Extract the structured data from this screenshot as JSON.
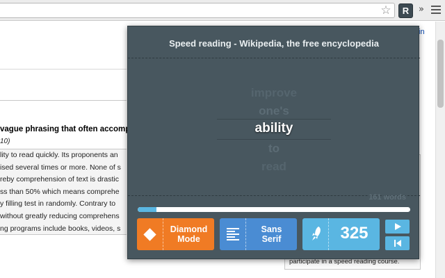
{
  "browser": {
    "extension_button_label": "R",
    "more_label": "»"
  },
  "page": {
    "login_fragment": "in",
    "heading": "vague phrasing that often accompa",
    "date_fragment": "10)",
    "article_lines": [
      "lity to read quickly. Its proponents an",
      "ised several times or more. None of s",
      "reby comprehension of text is drastic",
      "ss than 50% which means comprehe",
      "y filling test in randomly. Contrary to",
      "without greatly reducing comprehens",
      "ng programs include books, videos, s"
    ],
    "sidebar_text": "participate in a speed reading course."
  },
  "popup": {
    "title": "Speed reading - Wikipedia, the free encyclopedia",
    "words_before": [
      "improve",
      "one's"
    ],
    "focus_word": "ability",
    "words_after": [
      "to",
      "read"
    ],
    "word_count": "161 words",
    "progress_fraction": 0.07,
    "diamond_button": {
      "line1": "Diamond",
      "line2": "Mode"
    },
    "font_button": {
      "line1": "Sans",
      "line2": "Serif"
    },
    "speed_value": "325",
    "colors": {
      "background": "#48575f",
      "accent_orange": "#f07b24",
      "accent_blue": "#4a8cd3",
      "accent_light_blue": "#5ab6e2"
    }
  }
}
